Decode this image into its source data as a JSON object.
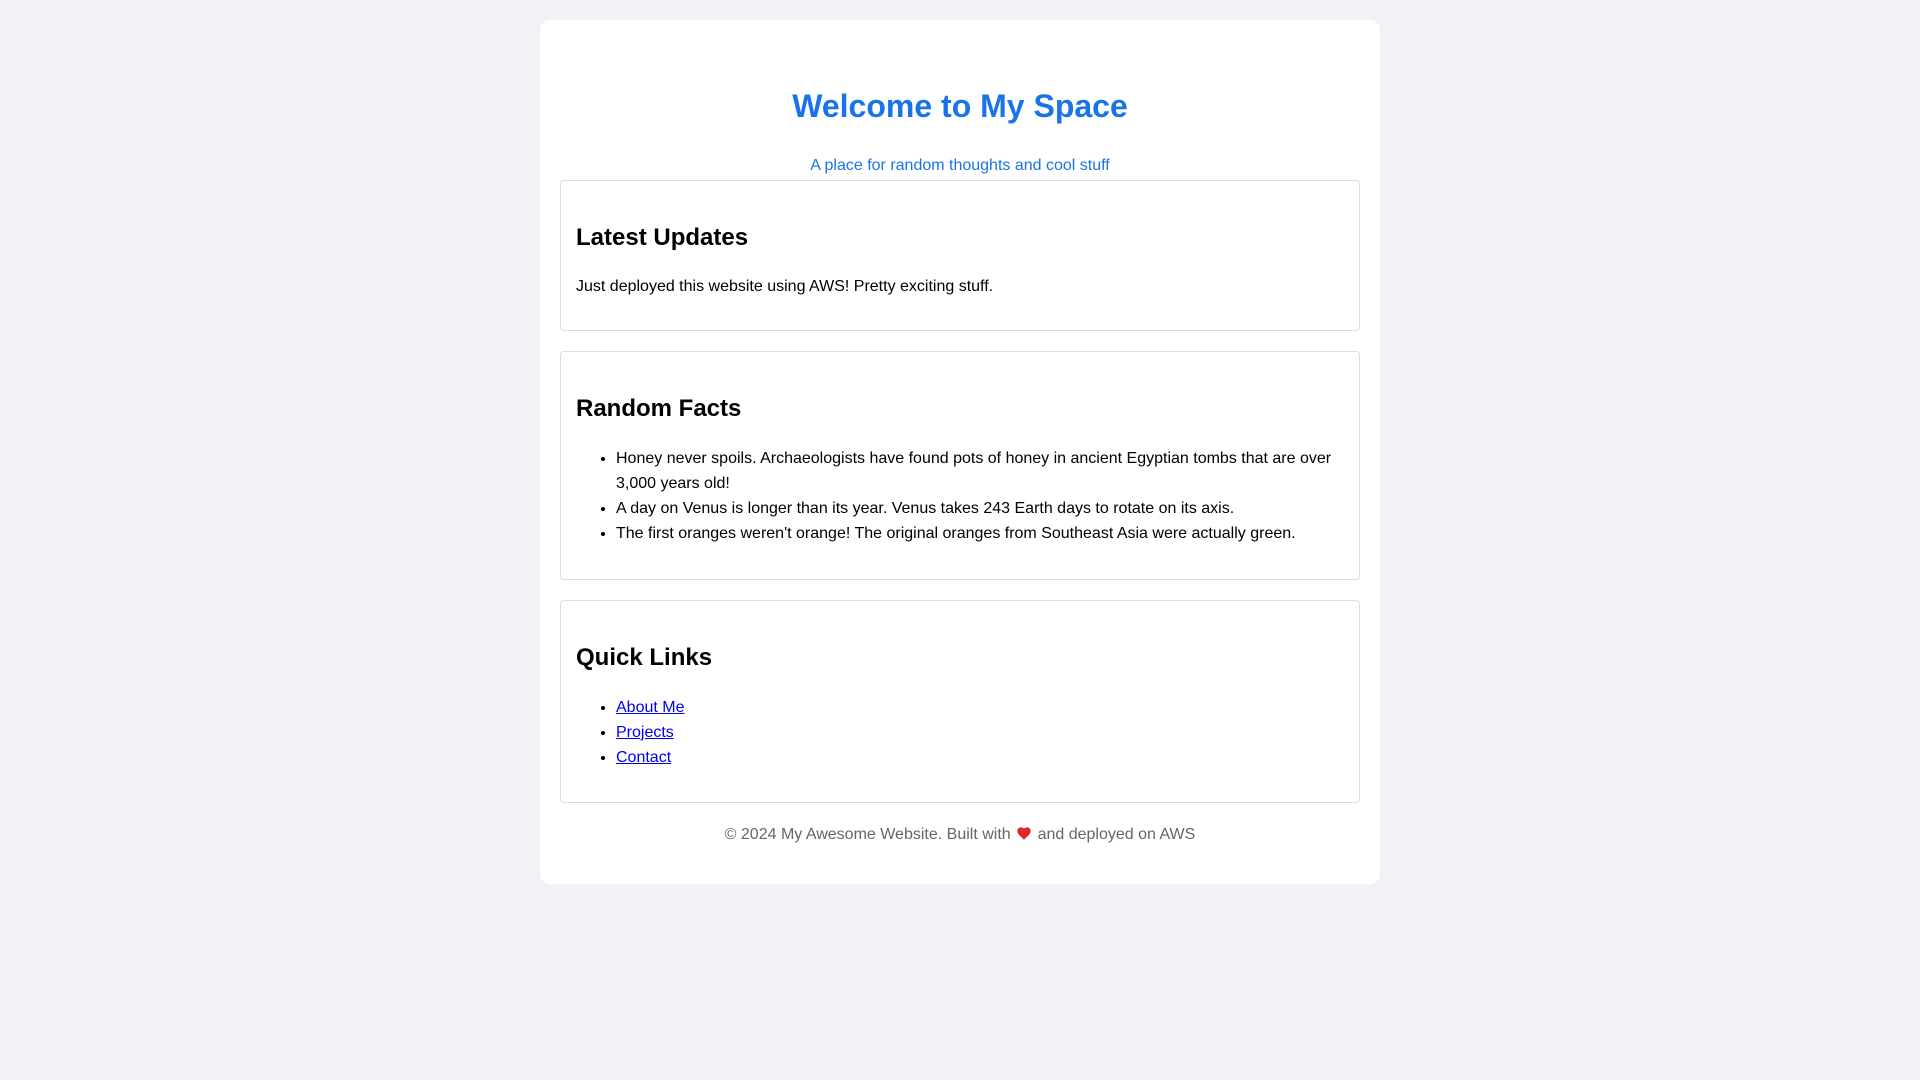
{
  "header": {
    "title": "Welcome to My Space",
    "subtitle": "A place for random thoughts and cool stuff"
  },
  "updates": {
    "heading": "Latest Updates",
    "text": "Just deployed this website using AWS! Pretty exciting stuff."
  },
  "facts": {
    "heading": "Random Facts",
    "items": [
      "Honey never spoils. Archaeologists have found pots of honey in ancient Egyptian tombs that are over 3,000 years old!",
      "A day on Venus is longer than its year. Venus takes 243 Earth days to rotate on its axis.",
      "The first oranges weren't orange! The original oranges from Southeast Asia were actually green."
    ]
  },
  "links": {
    "heading": "Quick Links",
    "items": [
      "About Me",
      "Projects",
      "Contact"
    ]
  },
  "footer": {
    "before_heart": "© 2024 My Awesome Website. Built with",
    "heart_icon": "heart-icon",
    "after_heart": "and deployed on AWS"
  },
  "colors": {
    "accent": "#1a73e8",
    "background": "#f0f2f5",
    "link": "#0000ee",
    "footer_text": "#666666",
    "heart": "#e0252b"
  }
}
